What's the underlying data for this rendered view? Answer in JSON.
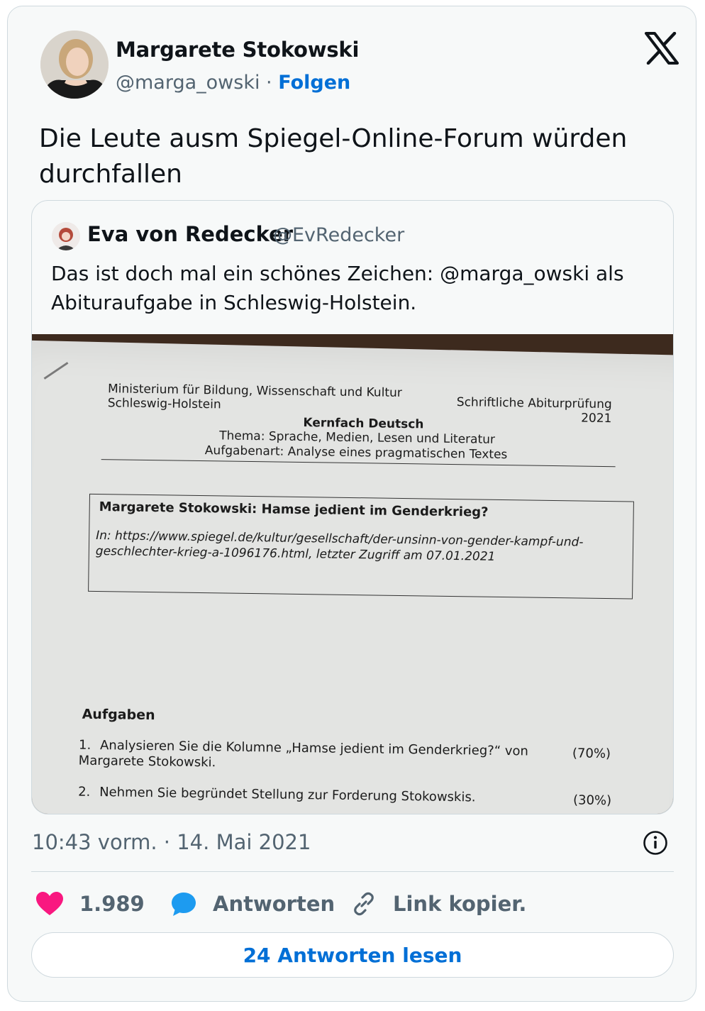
{
  "author": {
    "name": "Margarete Stokowski",
    "handle": "@marga_owski",
    "separator": " · ",
    "follow_label": "Folgen"
  },
  "tweet": {
    "text": "Die Leute ausm Spiegel-Online-Forum würden durchfallen"
  },
  "quote": {
    "name": "Eva von Redecker",
    "handle": "@EvRedecker",
    "text": "Das ist doch mal ein schönes Zeichen: @marga_owski als Abituraufgabe in Schleswig-Holstein.",
    "document": {
      "ministry_line1": "Ministerium für Bildung, Wissenschaft und Kultur",
      "ministry_line2": "Schleswig-Holstein",
      "exam_line1": "Schriftliche Abiturprüfung",
      "exam_line2": "2021",
      "subject": "Kernfach Deutsch",
      "theme": "Thema: Sprache, Medien, Lesen und Literatur",
      "task_type": "Aufgabenart: Analyse eines pragmatischen Textes",
      "box_title": "Margarete Stokowski: Hamse jedient im Genderkrieg?",
      "box_source": "In: https://www.spiegel.de/kultur/gesellschaft/der-unsinn-von-gender-kampf-und-geschlechter-krieg-a-1096176.html, letzter Zugriff am 07.01.2021",
      "tasks_heading": "Aufgaben",
      "tasks": [
        {
          "num": "1.",
          "text": "Analysieren Sie die Kolumne „Hamse jedient im Genderkrieg?“ von Margarete Stokowski.",
          "weight": "(70%)"
        },
        {
          "num": "2.",
          "text": "Nehmen Sie begründet Stellung zur Forderung Stokowskis.",
          "weight": "(30%)"
        }
      ]
    }
  },
  "meta": {
    "timestamp": "10:43 vorm. · 14. Mai 2021"
  },
  "actions": {
    "likes": "1.989",
    "reply_label": "Antworten",
    "copy_label": "Link kopier."
  },
  "read_replies_label": "24 Antworten lesen",
  "colors": {
    "accent": "#006fd6",
    "like": "#f91880",
    "reply": "#1d9bf0",
    "muted": "#536471"
  },
  "icons": [
    "x-logo-icon",
    "info-icon",
    "heart-icon",
    "speech-bubble-icon",
    "link-icon"
  ]
}
